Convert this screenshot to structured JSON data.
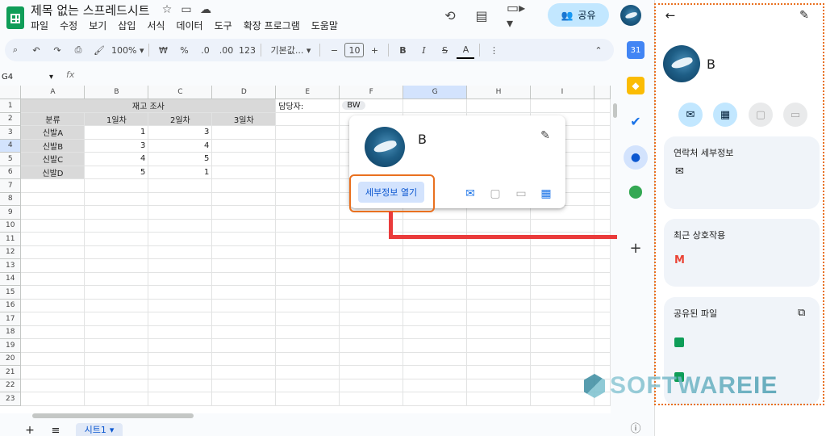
{
  "app": {
    "title": "제목 없는 스프레드시트"
  },
  "menu": [
    "파일",
    "수정",
    "보기",
    "삽입",
    "서식",
    "데이터",
    "도구",
    "확장 프로그램",
    "도움말"
  ],
  "share": {
    "label": "공유"
  },
  "toolbar": {
    "zoom": "100%",
    "currency": "₩",
    "percent": "%",
    "dec_less": ".0",
    "dec_more": ".00",
    "number_format": "123",
    "font": "기본값...",
    "font_size": "10",
    "bold": "B",
    "italic": "I",
    "text_color": "A"
  },
  "formula": {
    "cell_ref": "G4",
    "fx": "fx"
  },
  "columns": [
    "A",
    "B",
    "C",
    "D",
    "E",
    "F",
    "G",
    "H",
    "I"
  ],
  "rows": [
    "1",
    "2",
    "3",
    "4",
    "5",
    "6",
    "7",
    "8",
    "9",
    "10",
    "11",
    "12",
    "13",
    "14",
    "15",
    "16",
    "17",
    "18",
    "19",
    "20",
    "21",
    "22",
    "23"
  ],
  "sheet": {
    "title": "재고 조사",
    "manager_label": "담당자:",
    "manager_chip": "BW",
    "headers": [
      "분류",
      "1일차",
      "2일차",
      "3일차"
    ],
    "data": [
      {
        "name": "신발A",
        "d1": "1",
        "d2": "3"
      },
      {
        "name": "신발B",
        "d1": "3",
        "d2": "4"
      },
      {
        "name": "신발C",
        "d1": "4",
        "d2": "5"
      },
      {
        "name": "신발D",
        "d1": "5",
        "d2": "1"
      }
    ]
  },
  "sheet_tab": {
    "label": "시트1"
  },
  "card": {
    "name": "B",
    "open_details": "세부정보 열기"
  },
  "panel": {
    "name": "B",
    "contact_details": "연락처 세부정보",
    "recent_interactions": "최근 상호작용",
    "shared_files": "공유된 파일"
  },
  "watermark": "SOFTWAREIE",
  "colors": {
    "accent": "#0b57d0",
    "highlight": "#e9701f",
    "connector": "#ea3b3b",
    "share_bg": "#c2e7ff"
  }
}
